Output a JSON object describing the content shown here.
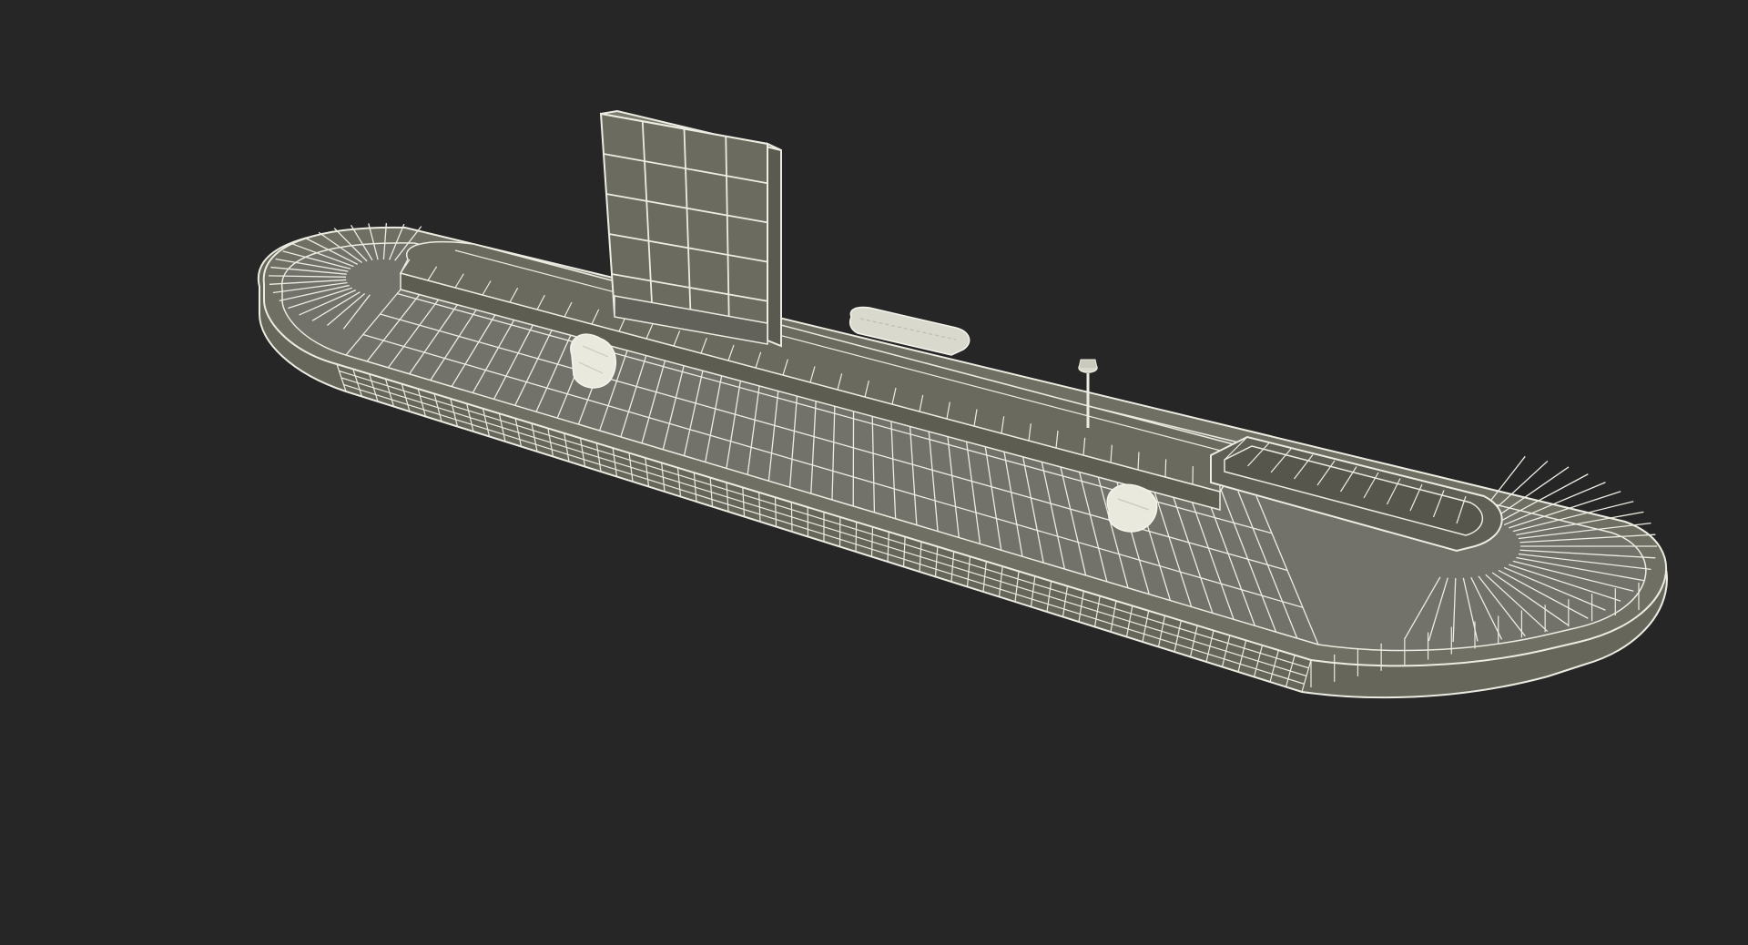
{
  "scene": {
    "subject": "baggage-carousel-wireframe",
    "render_mode": "wireframe",
    "colors": {
      "background": "#262626",
      "surface": "#6f6f63",
      "surface_dark": "#5d5d52",
      "surface_side": "#66665b",
      "wire": "#ecece2",
      "luggage": "#e9e9de"
    },
    "objects": [
      "carousel-base",
      "conveyor-belt",
      "center-island",
      "display-board",
      "luggage-bag",
      "sensor-post",
      "bag-chute"
    ]
  }
}
